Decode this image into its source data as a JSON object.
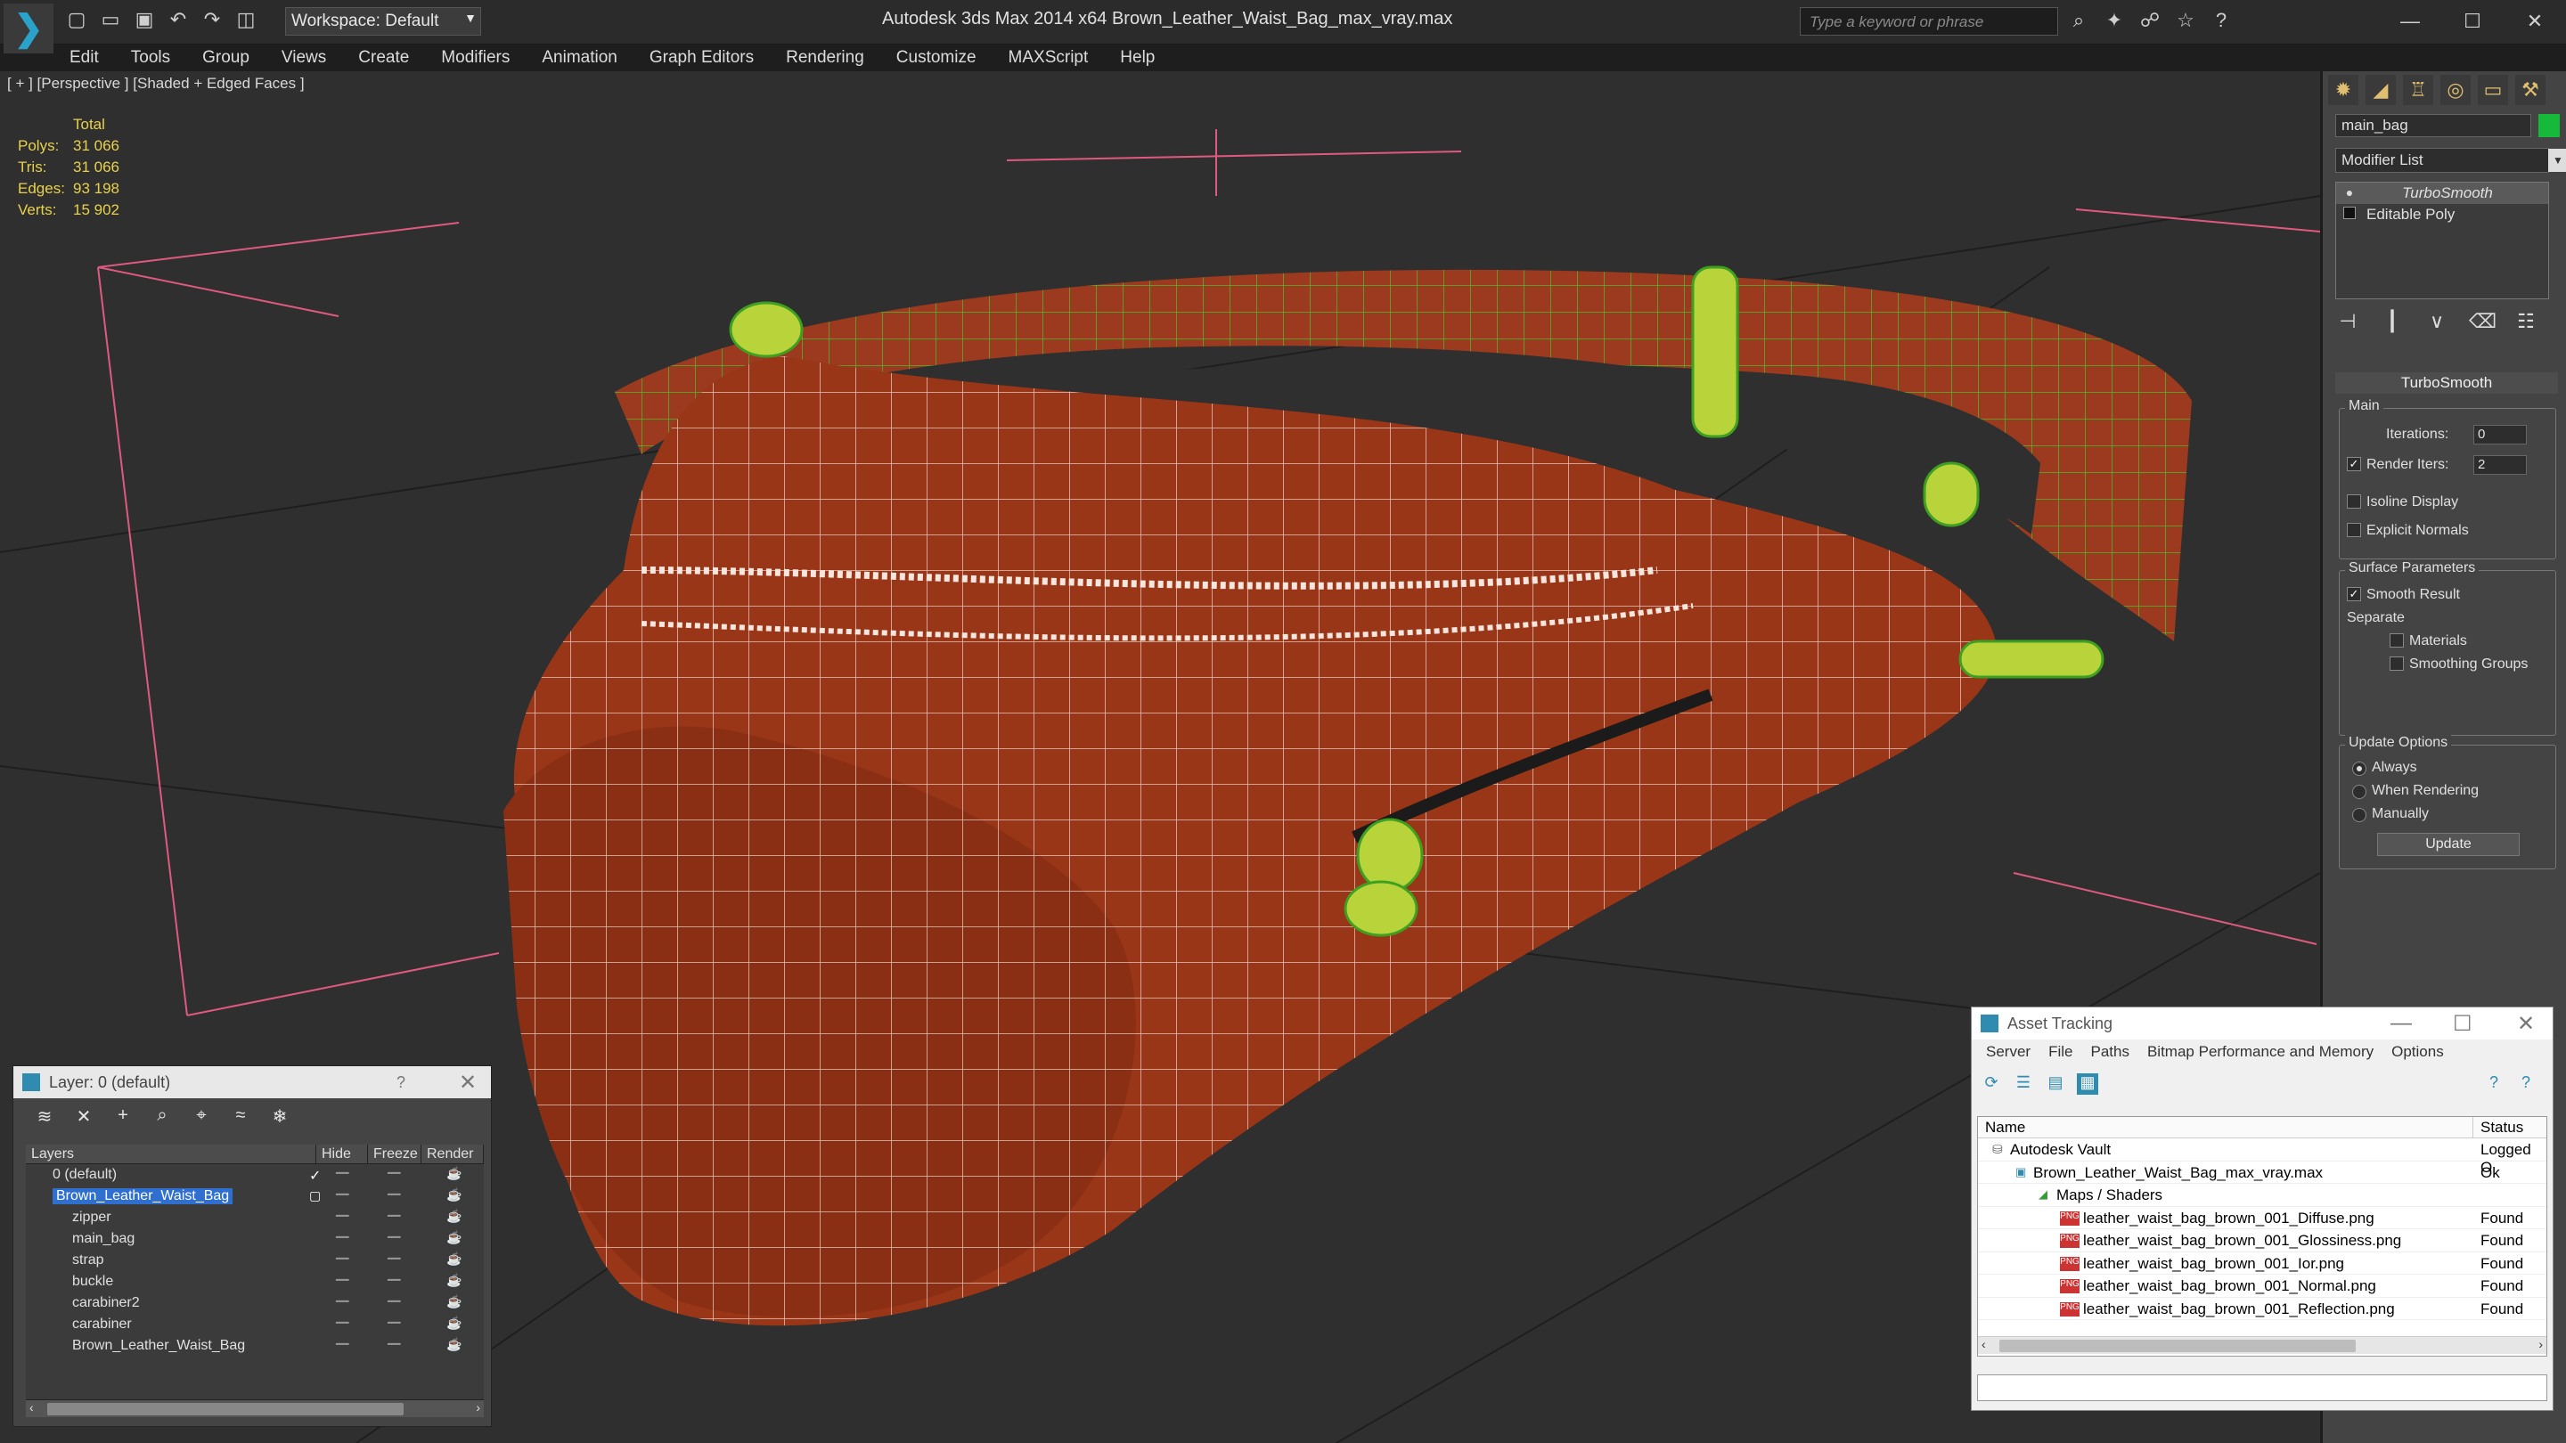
{
  "title_bar": {
    "workspace_label": "Workspace: Default",
    "window_title": "Autodesk 3ds Max  2014 x64      Brown_Leather_Waist_Bag_max_vray.max",
    "search_placeholder": "Type a keyword or phrase"
  },
  "menu": [
    "Edit",
    "Tools",
    "Group",
    "Views",
    "Create",
    "Modifiers",
    "Animation",
    "Graph Editors",
    "Rendering",
    "Customize",
    "MAXScript",
    "Help"
  ],
  "viewport": {
    "label": "[ + ] [Perspective ] [Shaded + Edged Faces ]",
    "stats_header": "Total",
    "stats": [
      {
        "k": "Polys:",
        "v": "31 066"
      },
      {
        "k": "Tris:",
        "v": "31 066"
      },
      {
        "k": "Edges:",
        "v": "93 198"
      },
      {
        "k": "Verts:",
        "v": "15 902"
      }
    ]
  },
  "command_panel": {
    "object_name": "main_bag",
    "object_color": "#16b93a",
    "modifier_list": "Modifier List",
    "stack": [
      "TurboSmooth",
      "Editable Poly"
    ],
    "rollout_title": "TurboSmooth",
    "main_group": "Main",
    "iterations_label": "Iterations:",
    "iterations_value": "0",
    "render_iters_label": "Render Iters:",
    "render_iters_value": "2",
    "isoline": "Isoline Display",
    "explicit": "Explicit Normals",
    "surface_group": "Surface Parameters",
    "smooth_result": "Smooth Result",
    "separate": "Separate",
    "materials": "Materials",
    "smoothing_groups": "Smoothing Groups",
    "update_group": "Update Options",
    "always": "Always",
    "when_rendering": "When Rendering",
    "manually": "Manually",
    "update_btn": "Update"
  },
  "layer_window": {
    "title": "Layer: 0 (default)",
    "help": "?",
    "columns": [
      "Layers",
      "Hide",
      "Freeze",
      "Render"
    ],
    "rows": [
      {
        "name": "0 (default)",
        "indent": 0
      },
      {
        "name": "Brown_Leather_Waist_Bag",
        "indent": 0,
        "selected": true
      },
      {
        "name": "zipper",
        "indent": 1
      },
      {
        "name": "main_bag",
        "indent": 1
      },
      {
        "name": "strap",
        "indent": 1
      },
      {
        "name": "buckle",
        "indent": 1
      },
      {
        "name": "carabiner2",
        "indent": 1
      },
      {
        "name": "carabiner",
        "indent": 1
      },
      {
        "name": "Brown_Leather_Waist_Bag",
        "indent": 1
      }
    ]
  },
  "asset_window": {
    "title": "Asset Tracking",
    "menu": [
      "Server",
      "File",
      "Paths",
      "Bitmap Performance and Memory",
      "Options"
    ],
    "columns": [
      "Name",
      "Status"
    ],
    "rows": [
      {
        "name": "Autodesk Vault",
        "status": "Logged O",
        "indent": 1
      },
      {
        "name": "Brown_Leather_Waist_Bag_max_vray.max",
        "status": "Ok",
        "indent": 2
      },
      {
        "name": "Maps / Shaders",
        "status": "",
        "indent": 3
      },
      {
        "name": "leather_waist_bag_brown_001_Diffuse.png",
        "status": "Found",
        "indent": 4
      },
      {
        "name": "leather_waist_bag_brown_001_Glossiness.png",
        "status": "Found",
        "indent": 4
      },
      {
        "name": "leather_waist_bag_brown_001_Ior.png",
        "status": "Found",
        "indent": 4
      },
      {
        "name": "leather_waist_bag_brown_001_Normal.png",
        "status": "Found",
        "indent": 4
      },
      {
        "name": "leather_waist_bag_brown_001_Reflection.png",
        "status": "Found",
        "indent": 4
      }
    ]
  }
}
